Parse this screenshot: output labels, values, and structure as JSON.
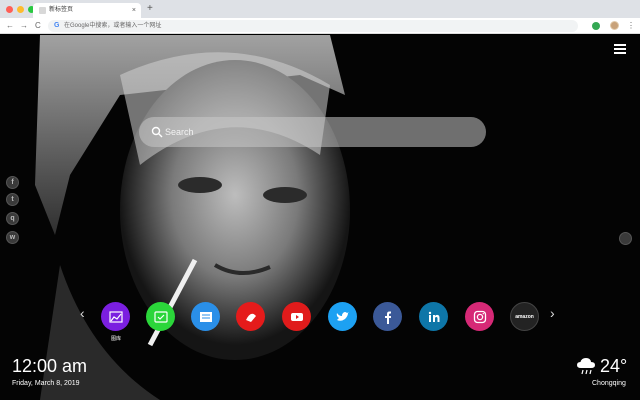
{
  "browser": {
    "tab_title": "新标签页",
    "tab_close": "×",
    "new_tab": "+",
    "back": "←",
    "forward": "→",
    "reload": "C",
    "omnibox_g": "G",
    "omnibox_placeholder": "在Google中搜索，或者输入一个网址",
    "menu": "⋮",
    "dot_colors": [
      "#ff5f57",
      "#febc2e",
      "#28c840"
    ]
  },
  "search": {
    "placeholder": "Search"
  },
  "social_icons": [
    {
      "name": "facebook-icon",
      "glyph": "f"
    },
    {
      "name": "twitter-icon",
      "glyph": "t"
    },
    {
      "name": "qq-icon",
      "glyph": "q"
    },
    {
      "name": "wechat-icon",
      "glyph": "w"
    }
  ],
  "apps": [
    {
      "name": "gallery-app",
      "color": "#7b1fe0"
    },
    {
      "name": "wechat-green-app",
      "color": "#2bd63a"
    },
    {
      "name": "news-app",
      "color": "#2a8fe8"
    },
    {
      "name": "game-app",
      "color": "#e51b1b"
    },
    {
      "name": "youtube-app",
      "color": "#e01b1b"
    },
    {
      "name": "twitter-app",
      "color": "#1da1f2"
    },
    {
      "name": "facebook-app",
      "color": "#3b5998"
    },
    {
      "name": "linkedin-app",
      "color": "#0e76a8"
    },
    {
      "name": "instagram-app",
      "color": "#d62976"
    },
    {
      "name": "amazon-app",
      "color": "#232323"
    }
  ],
  "app_labels": {
    "gallery": "图库",
    "amazon": "amazon"
  },
  "arrows": {
    "prev": "‹",
    "next": "›"
  },
  "clock": {
    "time": "12:00 am",
    "date": "Friday, March 8, 2019"
  },
  "weather": {
    "temperature": "24°",
    "city": "Chongqing",
    "icon": "cloud-rain-icon"
  }
}
